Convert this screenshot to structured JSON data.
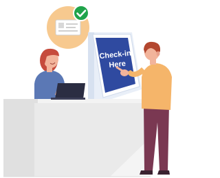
{
  "kiosk": {
    "screen_text_line1": "Check-in",
    "screen_text_line2": "Here"
  },
  "badge": {
    "icon": "id-card-icon",
    "status_icon": "checkmark-circle-icon"
  },
  "colors": {
    "badge_bg": "#f7c98f",
    "check_green": "#1fa34a",
    "kiosk_screen": "#2f4aa0",
    "kiosk_body": "#e9eff8",
    "counter_front": "#e6e6e6",
    "counter_top": "#f3f3f3",
    "receptionist_shirt": "#5b78b5",
    "receptionist_hair": "#c64b3c",
    "customer_shirt": "#f5b56a",
    "customer_pants": "#7a3852",
    "customer_hair": "#b3472f",
    "skin": "#f2b49b",
    "laptop": "#2b2d42"
  }
}
